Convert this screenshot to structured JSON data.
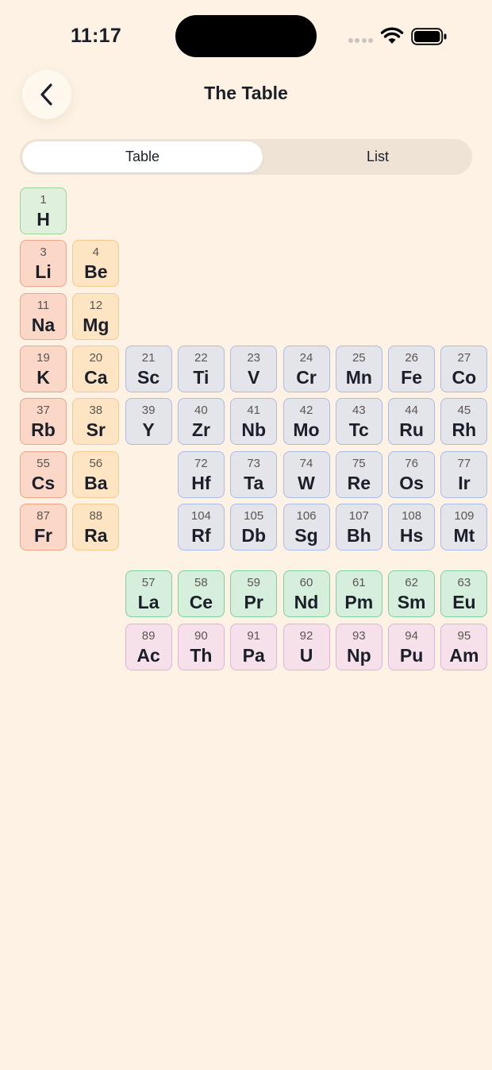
{
  "status": {
    "time": "11:17"
  },
  "header": {
    "title": "The Table"
  },
  "tabs": [
    {
      "label": "Table",
      "active": true
    },
    {
      "label": "List",
      "active": false
    }
  ],
  "colors": {
    "background": "#FDF2E4",
    "nonmetal": "#DFF1DD",
    "alkali": "#FAD7C6",
    "alkaline": "#FDE4C3",
    "transition": "#E4E4EB",
    "lanthanide": "#D6EEDC",
    "actinide": "#F6E1EA"
  },
  "elements": [
    {
      "n": "1",
      "s": "H",
      "cat": "nonmetal",
      "row": 0,
      "col": 0
    },
    {
      "n": "3",
      "s": "Li",
      "cat": "alkali",
      "row": 1,
      "col": 0
    },
    {
      "n": "4",
      "s": "Be",
      "cat": "alkaline",
      "row": 1,
      "col": 1
    },
    {
      "n": "11",
      "s": "Na",
      "cat": "alkali",
      "row": 2,
      "col": 0
    },
    {
      "n": "12",
      "s": "Mg",
      "cat": "alkaline",
      "row": 2,
      "col": 1
    },
    {
      "n": "19",
      "s": "K",
      "cat": "alkali",
      "row": 3,
      "col": 0
    },
    {
      "n": "20",
      "s": "Ca",
      "cat": "alkaline",
      "row": 3,
      "col": 1
    },
    {
      "n": "21",
      "s": "Sc",
      "cat": "transition",
      "row": 3,
      "col": 2
    },
    {
      "n": "22",
      "s": "Ti",
      "cat": "transition",
      "row": 3,
      "col": 3
    },
    {
      "n": "23",
      "s": "V",
      "cat": "transition",
      "row": 3,
      "col": 4
    },
    {
      "n": "24",
      "s": "Cr",
      "cat": "transition",
      "row": 3,
      "col": 5
    },
    {
      "n": "25",
      "s": "Mn",
      "cat": "transition",
      "row": 3,
      "col": 6
    },
    {
      "n": "26",
      "s": "Fe",
      "cat": "transition",
      "row": 3,
      "col": 7
    },
    {
      "n": "27",
      "s": "Co",
      "cat": "transition",
      "row": 3,
      "col": 8
    },
    {
      "n": "37",
      "s": "Rb",
      "cat": "alkali",
      "row": 4,
      "col": 0
    },
    {
      "n": "38",
      "s": "Sr",
      "cat": "alkaline",
      "row": 4,
      "col": 1
    },
    {
      "n": "39",
      "s": "Y",
      "cat": "transition",
      "row": 4,
      "col": 2
    },
    {
      "n": "40",
      "s": "Zr",
      "cat": "transition",
      "row": 4,
      "col": 3
    },
    {
      "n": "41",
      "s": "Nb",
      "cat": "transition",
      "row": 4,
      "col": 4
    },
    {
      "n": "42",
      "s": "Mo",
      "cat": "transition",
      "row": 4,
      "col": 5
    },
    {
      "n": "43",
      "s": "Tc",
      "cat": "transition",
      "row": 4,
      "col": 6
    },
    {
      "n": "44",
      "s": "Ru",
      "cat": "transition",
      "row": 4,
      "col": 7
    },
    {
      "n": "45",
      "s": "Rh",
      "cat": "transition",
      "row": 4,
      "col": 8
    },
    {
      "n": "55",
      "s": "Cs",
      "cat": "alkali",
      "row": 5,
      "col": 0
    },
    {
      "n": "56",
      "s": "Ba",
      "cat": "alkaline",
      "row": 5,
      "col": 1
    },
    {
      "n": "72",
      "s": "Hf",
      "cat": "transition",
      "row": 5,
      "col": 3
    },
    {
      "n": "73",
      "s": "Ta",
      "cat": "transition",
      "row": 5,
      "col": 4
    },
    {
      "n": "74",
      "s": "W",
      "cat": "transition",
      "row": 5,
      "col": 5
    },
    {
      "n": "75",
      "s": "Re",
      "cat": "transition",
      "row": 5,
      "col": 6
    },
    {
      "n": "76",
      "s": "Os",
      "cat": "transition",
      "row": 5,
      "col": 7
    },
    {
      "n": "77",
      "s": "Ir",
      "cat": "transition",
      "row": 5,
      "col": 8
    },
    {
      "n": "87",
      "s": "Fr",
      "cat": "alkali",
      "row": 6,
      "col": 0
    },
    {
      "n": "88",
      "s": "Ra",
      "cat": "alkaline",
      "row": 6,
      "col": 1
    },
    {
      "n": "104",
      "s": "Rf",
      "cat": "transition",
      "row": 6,
      "col": 3
    },
    {
      "n": "105",
      "s": "Db",
      "cat": "transition",
      "row": 6,
      "col": 4
    },
    {
      "n": "106",
      "s": "Sg",
      "cat": "transition",
      "row": 6,
      "col": 5
    },
    {
      "n": "107",
      "s": "Bh",
      "cat": "transition",
      "row": 6,
      "col": 6
    },
    {
      "n": "108",
      "s": "Hs",
      "cat": "transition",
      "row": 6,
      "col": 7
    },
    {
      "n": "109",
      "s": "Mt",
      "cat": "transition",
      "row": 6,
      "col": 8
    },
    {
      "n": "57",
      "s": "La",
      "cat": "lanthanide",
      "row": 7,
      "col": 2
    },
    {
      "n": "58",
      "s": "Ce",
      "cat": "lanthanide",
      "row": 7,
      "col": 3
    },
    {
      "n": "59",
      "s": "Pr",
      "cat": "lanthanide",
      "row": 7,
      "col": 4
    },
    {
      "n": "60",
      "s": "Nd",
      "cat": "lanthanide",
      "row": 7,
      "col": 5
    },
    {
      "n": "61",
      "s": "Pm",
      "cat": "lanthanide",
      "row": 7,
      "col": 6
    },
    {
      "n": "62",
      "s": "Sm",
      "cat": "lanthanide",
      "row": 7,
      "col": 7
    },
    {
      "n": "63",
      "s": "Eu",
      "cat": "lanthanide",
      "row": 7,
      "col": 8
    },
    {
      "n": "89",
      "s": "Ac",
      "cat": "actinide",
      "row": 8,
      "col": 2
    },
    {
      "n": "90",
      "s": "Th",
      "cat": "actinide",
      "row": 8,
      "col": 3
    },
    {
      "n": "91",
      "s": "Pa",
      "cat": "actinide",
      "row": 8,
      "col": 4
    },
    {
      "n": "92",
      "s": "U",
      "cat": "actinide",
      "row": 8,
      "col": 5
    },
    {
      "n": "93",
      "s": "Np",
      "cat": "actinide",
      "row": 8,
      "col": 6
    },
    {
      "n": "94",
      "s": "Pu",
      "cat": "actinide",
      "row": 8,
      "col": 7
    },
    {
      "n": "95",
      "s": "Am",
      "cat": "actinide",
      "row": 8,
      "col": 8
    }
  ]
}
